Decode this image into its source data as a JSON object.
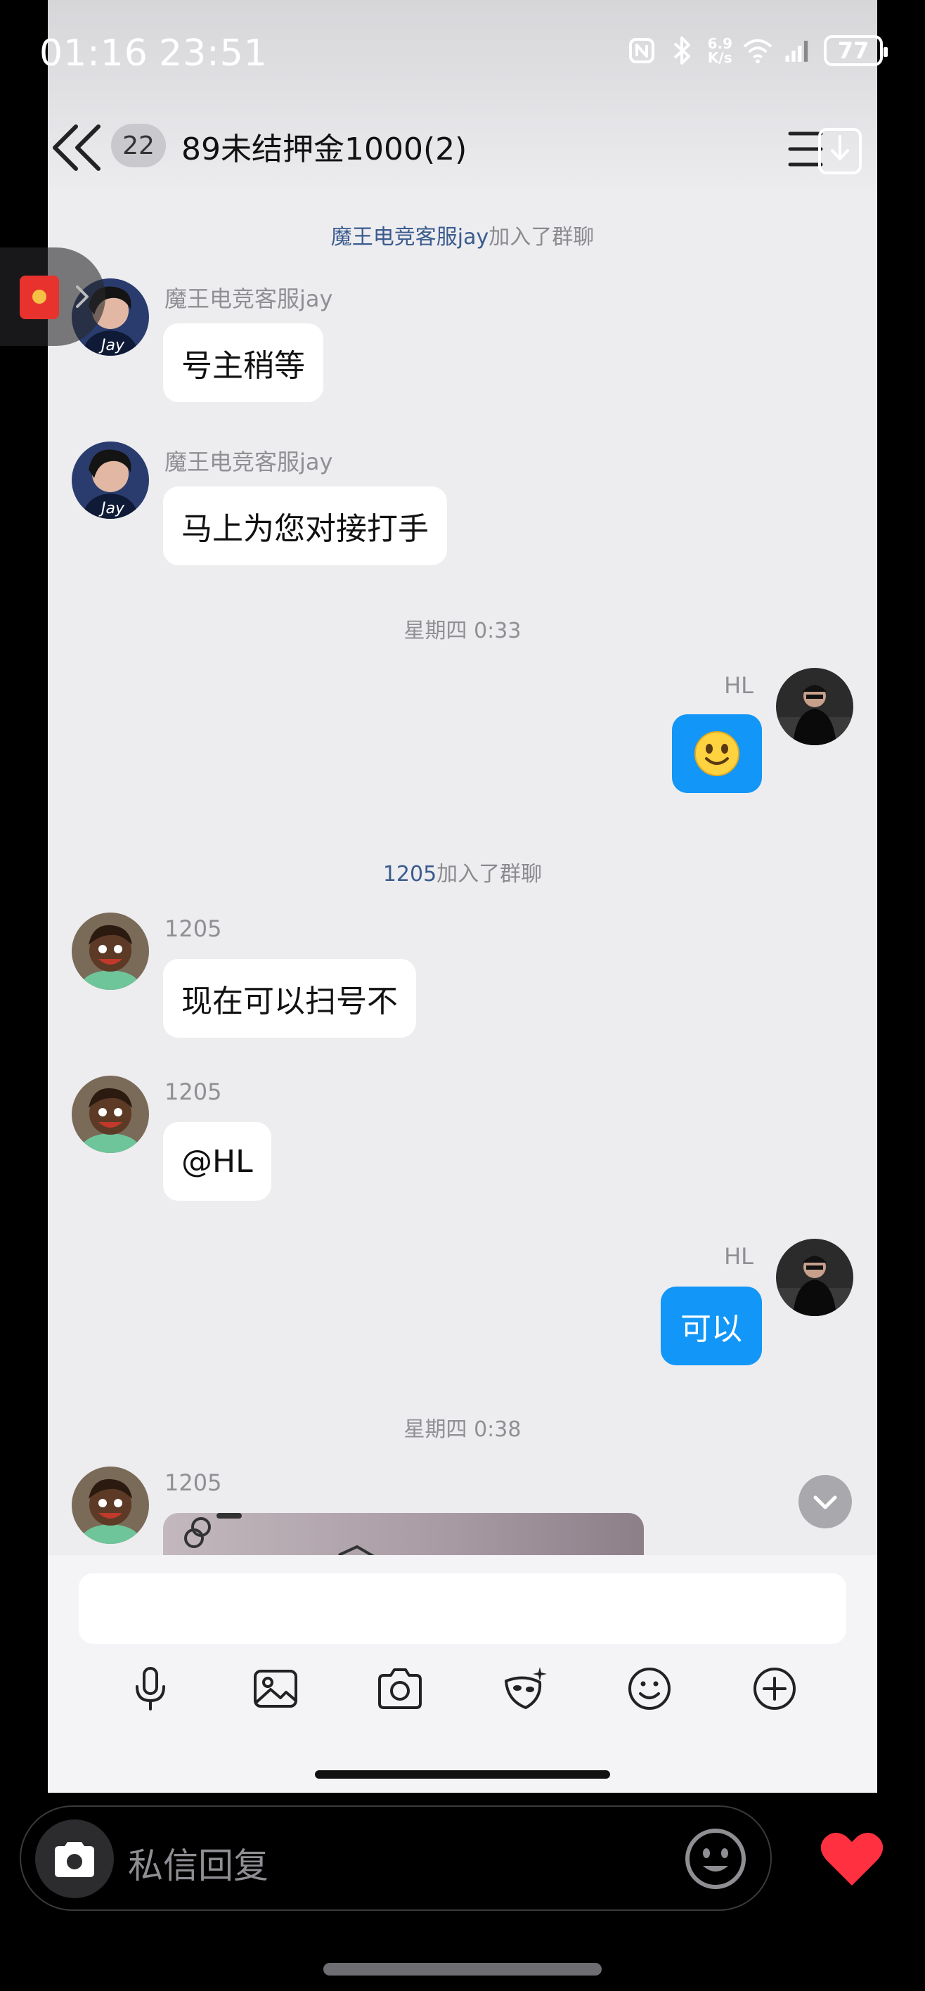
{
  "status_bar": {
    "time_left": "01:16",
    "time_right": "23:51",
    "net_speed_top": "6.9",
    "net_speed_bottom": "K/s",
    "battery": "77"
  },
  "header": {
    "unread_count": "22",
    "title": "89未结押金1000(2)"
  },
  "messages": {
    "sys1": {
      "who": "魔王电竞客服jay",
      "text": "加入了群聊"
    },
    "m1": {
      "sender": "魔王电竞客服jay",
      "text": "号主稍等"
    },
    "m2": {
      "sender": "魔王电竞客服jay",
      "text": "马上为您对接打手"
    },
    "time1": "星期四 0:33",
    "m3": {
      "sender": "HL",
      "emoji": "🙂"
    },
    "sys2": {
      "who": "1205",
      "text": "加入了群聊"
    },
    "m4": {
      "sender": "1205",
      "text": "现在可以扫号不"
    },
    "m5": {
      "sender": "1205",
      "text": "@HL"
    },
    "m6": {
      "sender": "HL",
      "text": "可以"
    },
    "time2": "星期四 0:38",
    "m7": {
      "sender": "1205"
    }
  },
  "reply_bar": {
    "placeholder": "私信回复"
  },
  "colors": {
    "outgoing_bubble": "#1296f7",
    "system_name": "#3b5b8e",
    "heart": "#ff3040"
  }
}
